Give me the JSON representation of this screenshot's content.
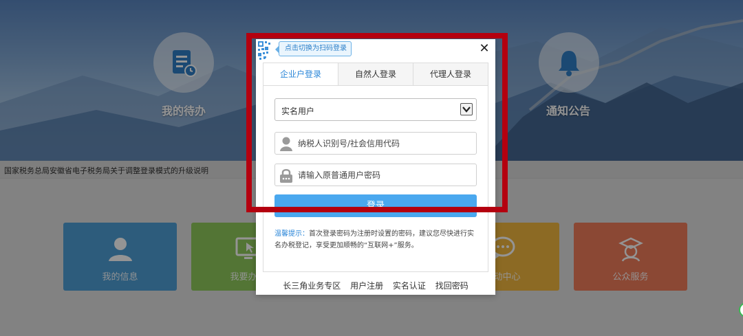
{
  "hero": {
    "left_label": "我的待办",
    "right_label": "通知公告"
  },
  "notice": {
    "text": "国家税务总局安徽省电子税务局关于调整登录模式的升级说明"
  },
  "tiles": [
    {
      "label": "我的信息",
      "color": "#4f9fd6",
      "icon": "user-icon"
    },
    {
      "label": "我要办税",
      "color": "#8fca5c",
      "icon": "monitor-icon"
    },
    {
      "label": "互动中心",
      "color": "#f1b73f",
      "icon": "chat-icon"
    },
    {
      "label": "公众服务",
      "color": "#f07c5a",
      "icon": "service-icon"
    }
  ],
  "dialog": {
    "qr_tip": "点击切换为扫码登录",
    "close": "✕",
    "tabs": [
      {
        "label": "企业户登录",
        "active": true
      },
      {
        "label": "自然人登录",
        "active": false
      },
      {
        "label": "代理人登录",
        "active": false
      }
    ],
    "user_type_select": "实名用户",
    "taxpayer_id_placeholder": "纳税人识别号/社会信用代码",
    "password_placeholder": "请输入原普通用户密码",
    "login_button": "登录",
    "tip_title": "温馨提示：",
    "tip_body": "首次登录密码为注册时设置的密码，建议您尽快进行实名办税登记，享受更加顺畅的“互联网+”服务。",
    "links": [
      "长三角业务专区",
      "用户注册",
      "实名认证",
      "找回密码"
    ]
  },
  "colors": {
    "accent": "#2a86d8",
    "highlight_frame": "#b4000f",
    "login_button": "#4aa8ef"
  }
}
